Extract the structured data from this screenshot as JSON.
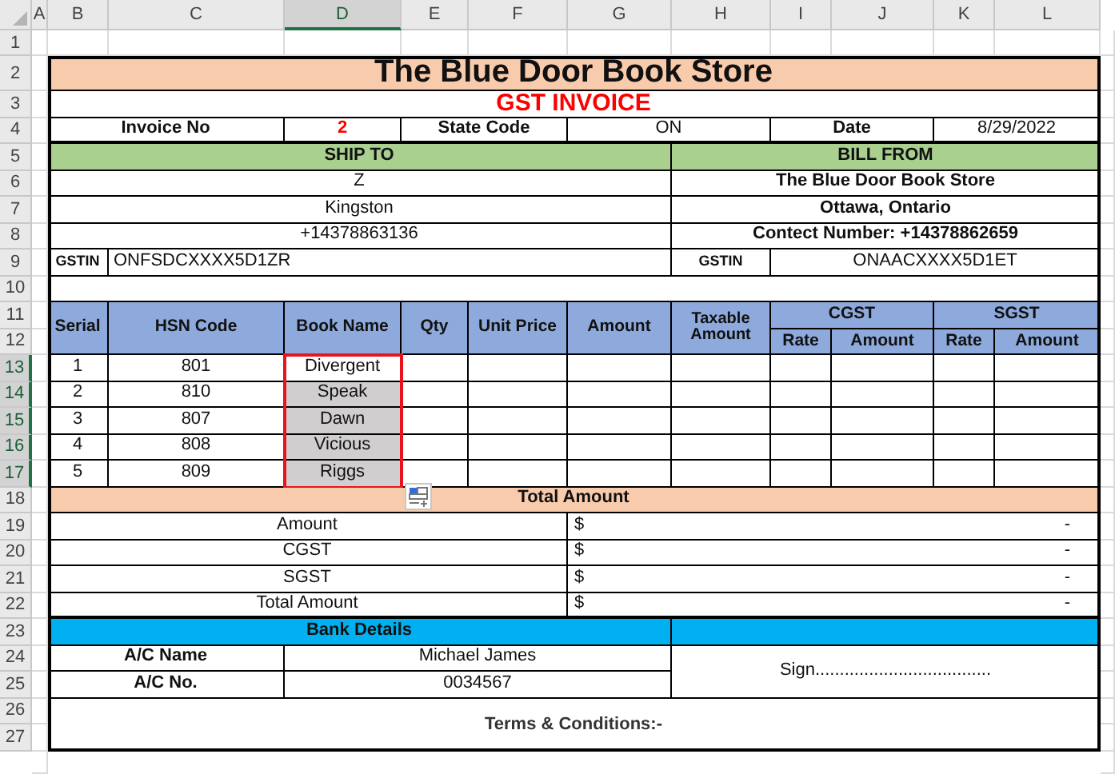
{
  "sheet": {
    "column_headers": [
      {
        "label": "A",
        "selected": false
      },
      {
        "label": "B",
        "selected": false
      },
      {
        "label": "C",
        "selected": false
      },
      {
        "label": "D",
        "selected": true
      },
      {
        "label": "E",
        "selected": false
      },
      {
        "label": "F",
        "selected": false
      },
      {
        "label": "G",
        "selected": false
      },
      {
        "label": "H",
        "selected": false
      },
      {
        "label": "I",
        "selected": false
      },
      {
        "label": "J",
        "selected": false
      },
      {
        "label": "K",
        "selected": false
      },
      {
        "label": "L",
        "selected": false
      }
    ],
    "row_headers": [
      {
        "label": "1",
        "selected": false
      },
      {
        "label": "2",
        "selected": false
      },
      {
        "label": "3",
        "selected": false
      },
      {
        "label": "4",
        "selected": false
      },
      {
        "label": "5",
        "selected": false
      },
      {
        "label": "6",
        "selected": false
      },
      {
        "label": "7",
        "selected": false
      },
      {
        "label": "8",
        "selected": false
      },
      {
        "label": "9",
        "selected": false
      },
      {
        "label": "10",
        "selected": false
      },
      {
        "label": "11",
        "selected": false
      },
      {
        "label": "12",
        "selected": false
      },
      {
        "label": "13",
        "selected": true
      },
      {
        "label": "14",
        "selected": true
      },
      {
        "label": "15",
        "selected": true
      },
      {
        "label": "16",
        "selected": true
      },
      {
        "label": "17",
        "selected": true
      },
      {
        "label": "18",
        "selected": false
      },
      {
        "label": "19",
        "selected": false
      },
      {
        "label": "20",
        "selected": false
      },
      {
        "label": "21",
        "selected": false
      },
      {
        "label": "22",
        "selected": false
      },
      {
        "label": "23",
        "selected": false
      },
      {
        "label": "24",
        "selected": false
      },
      {
        "label": "25",
        "selected": false
      },
      {
        "label": "26",
        "selected": false
      },
      {
        "label": "27",
        "selected": false
      }
    ]
  },
  "invoice": {
    "title": "The Blue Door Book Store",
    "subtitle": "GST INVOICE",
    "fields": [
      {
        "label": "Invoice No",
        "value": "2"
      },
      {
        "label": "State Code",
        "value": "ON"
      },
      {
        "label": "Date",
        "value": "8/29/2022"
      }
    ]
  },
  "ship_to": {
    "heading": "SHIP TO",
    "lines": [
      "Z",
      "Kingston",
      "+14378863136"
    ],
    "gstin_label": "GSTIN",
    "gstin": "ONFSDCXXXX5D1ZR"
  },
  "bill_from": {
    "heading": "BILL FROM",
    "lines": [
      "The Blue Door Book Store",
      "Ottawa, Ontario",
      "Contect Number: +14378862659"
    ],
    "gstin_label": "GSTIN",
    "gstin": "ONAACXXXX5D1ET"
  },
  "items": {
    "columns": [
      "Serial",
      "HSN Code",
      "Book Name",
      "Qty",
      "Unit Price",
      "Amount",
      "Taxable Amount"
    ],
    "tax_groups": [
      {
        "label": "CGST",
        "sub_columns": [
          "Rate",
          "Amount"
        ]
      },
      {
        "label": "SGST",
        "sub_columns": [
          "Rate",
          "Amount"
        ]
      }
    ],
    "rows": [
      {
        "serial": "1",
        "hsn_code": "801",
        "book_name": "Divergent",
        "selected": true,
        "active": true
      },
      {
        "serial": "2",
        "hsn_code": "810",
        "book_name": "Speak",
        "selected": true,
        "active": false
      },
      {
        "serial": "3",
        "hsn_code": "807",
        "book_name": "Dawn",
        "selected": true,
        "active": false
      },
      {
        "serial": "4",
        "hsn_code": "808",
        "book_name": "Vicious",
        "selected": true,
        "active": false
      },
      {
        "serial": "5",
        "hsn_code": "809",
        "book_name": "Riggs",
        "selected": true,
        "active": false
      }
    ]
  },
  "totals": {
    "heading": "Total Amount",
    "rows": [
      {
        "label": "Amount",
        "currency": "$",
        "value": "-"
      },
      {
        "label": "CGST",
        "currency": "$",
        "value": "-"
      },
      {
        "label": "SGST",
        "currency": "$",
        "value": "-"
      },
      {
        "label": "Total Amount",
        "currency": "$",
        "value": "-"
      }
    ]
  },
  "bank": {
    "heading": "Bank Details",
    "rows": [
      {
        "label": "A/C Name",
        "value": "Michael James"
      },
      {
        "label": "A/C No.",
        "value": "0034567"
      }
    ],
    "sign": "Sign...................................."
  },
  "terms": "Terms & Conditions:-"
}
